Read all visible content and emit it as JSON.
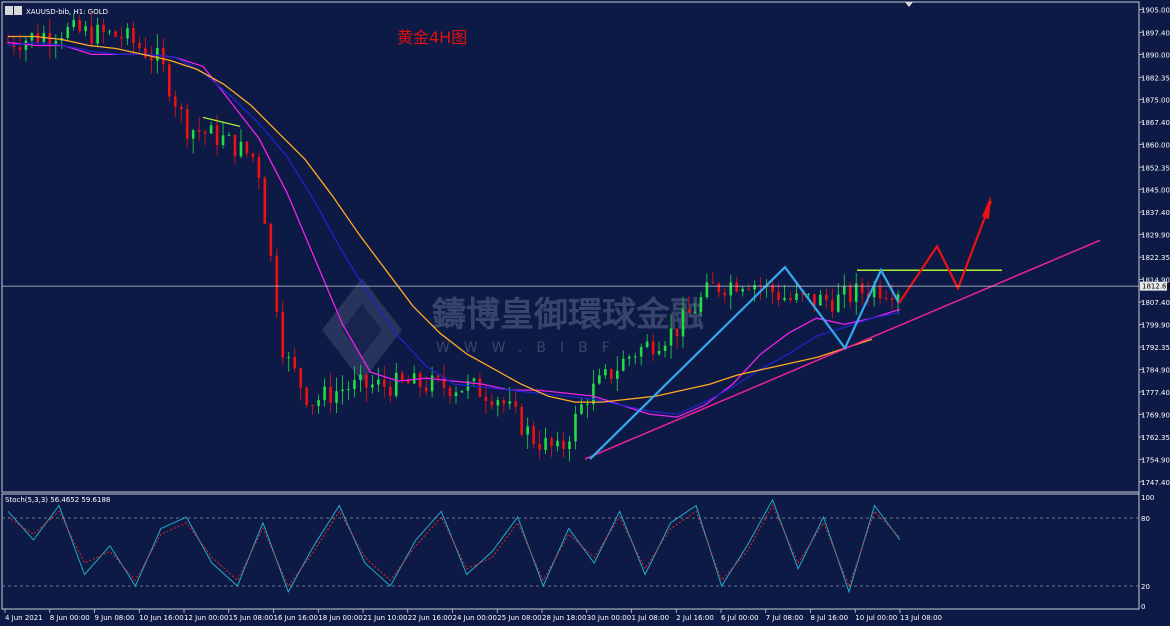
{
  "header": {
    "symbol_info": "XAUUSD-bib, H1:  GOLD",
    "chart_title": "黄金4H图"
  },
  "watermark": {
    "main": "鑄博皇御環球金融",
    "sub": "WWW.BIBF"
  },
  "current_price_label": "1812.69",
  "colors": {
    "background": "#0d1a45",
    "bull_candle": "#22dd44",
    "bear_candle": "#ee1111",
    "ma_fast": "#ee22ee",
    "ma_mid": "#2222cc",
    "ma_slow": "#ffaa22",
    "trendline": "#ee2299",
    "pattern": "#33aaee",
    "resistance": "#aaee33",
    "projection": "#ee1111",
    "stoch_main": "#22aacc",
    "stoch_signal": "#ee2222"
  },
  "stoch_panel": {
    "label": "Stoch(5,3,3) 56.4652 59.6188",
    "axis_labels": [
      "100",
      "80",
      "20",
      "0"
    ]
  },
  "chart_data": [
    {
      "type": "candlestick",
      "title": "黄金4H图",
      "symbol": "XAUUSD",
      "ylim": [
        1744.0,
        1907.5
      ],
      "y_ticks": [
        "1905.00",
        "1897.40",
        "1890.00",
        "1882.35",
        "1875.00",
        "1867.40",
        "1860.00",
        "1852.35",
        "1845.00",
        "1837.40",
        "1829.90",
        "1822.35",
        "1814.90",
        "1807.40",
        "1799.90",
        "1792.35",
        "1784.90",
        "1777.40",
        "1769.90",
        "1762.35",
        "1754.90",
        "1747.40"
      ],
      "x_ticks": [
        "4 Jun 2021",
        "8 Jun 00:00",
        "9 Jun 08:00",
        "10 Jun 16:00",
        "12 Jun 00:00",
        "15 Jun 08:00",
        "16 Jun 16:00",
        "18 Jun 00:00",
        "21 Jun 10:00",
        "22 Jun 16:00",
        "24 Jun 00:00",
        "25 Jun 08:00",
        "28 Jun 18:00",
        "30 Jun 00:00",
        "1 Jul 08:00",
        "2 Jul 16:00",
        "6 Jul 00:00",
        "7 Jul 08:00",
        "8 Jul 16:00",
        "10 Jul 00:00",
        "13 Jul 08:00"
      ],
      "current_price": 1812.69,
      "trendline": {
        "x": [
          0.5,
          1.0
        ],
        "y": [
          1755,
          1828
        ]
      },
      "resistance_level": 1818,
      "series": [
        {
          "name": "ma_fast",
          "values": [
            1894,
            1893,
            1893,
            1890,
            1890,
            1890,
            1889,
            1886,
            1874,
            1862,
            1844,
            1822,
            1800,
            1784,
            1781,
            1782,
            1781,
            1780,
            1778,
            1778,
            1777,
            1776,
            1773,
            1770,
            1769,
            1773,
            1780,
            1790,
            1797,
            1802,
            1800,
            1802,
            1805
          ]
        },
        {
          "name": "ma_mid",
          "values": [
            1893,
            1894,
            1893,
            1891,
            1890,
            1890,
            1889,
            1884,
            1876,
            1867,
            1856,
            1841,
            1824,
            1809,
            1796,
            1786,
            1780,
            1779,
            1778,
            1777,
            1776,
            1775,
            1773,
            1771,
            1770,
            1774,
            1779,
            1785,
            1790,
            1796,
            1799,
            1802,
            1804
          ]
        },
        {
          "name": "ma_slow",
          "values": [
            1896,
            1896,
            1895,
            1893,
            1892,
            1890,
            1888,
            1885,
            1880,
            1873,
            1864,
            1855,
            1843,
            1830,
            1818,
            1806,
            1797,
            1790,
            1785,
            1780,
            1776,
            1774,
            1774,
            1775,
            1776,
            1778,
            1780,
            1783,
            1785,
            1787,
            1789,
            1792,
            1795
          ]
        }
      ],
      "ohlc_summary": {
        "high": 1903,
        "low": 1751,
        "last": 1812.69
      }
    },
    {
      "type": "line",
      "title": "Stoch(5,3,3)",
      "ylim": [
        0,
        100
      ],
      "series": [
        {
          "name": "main",
          "values": [
            85,
            60,
            90,
            30,
            55,
            20,
            70,
            80,
            40,
            20,
            75,
            15,
            55,
            90,
            40,
            20,
            60,
            85,
            30,
            50,
            80,
            20,
            70,
            40,
            85,
            30,
            75,
            90,
            20,
            55,
            95,
            35,
            80,
            15,
            90,
            60
          ]
        },
        {
          "name": "signal",
          "values": [
            80,
            65,
            85,
            40,
            50,
            25,
            65,
            75,
            45,
            25,
            70,
            20,
            50,
            85,
            45,
            25,
            55,
            80,
            35,
            45,
            75,
            25,
            65,
            45,
            80,
            35,
            70,
            85,
            25,
            50,
            90,
            40,
            75,
            20,
            85,
            62
          ]
        }
      ]
    }
  ]
}
